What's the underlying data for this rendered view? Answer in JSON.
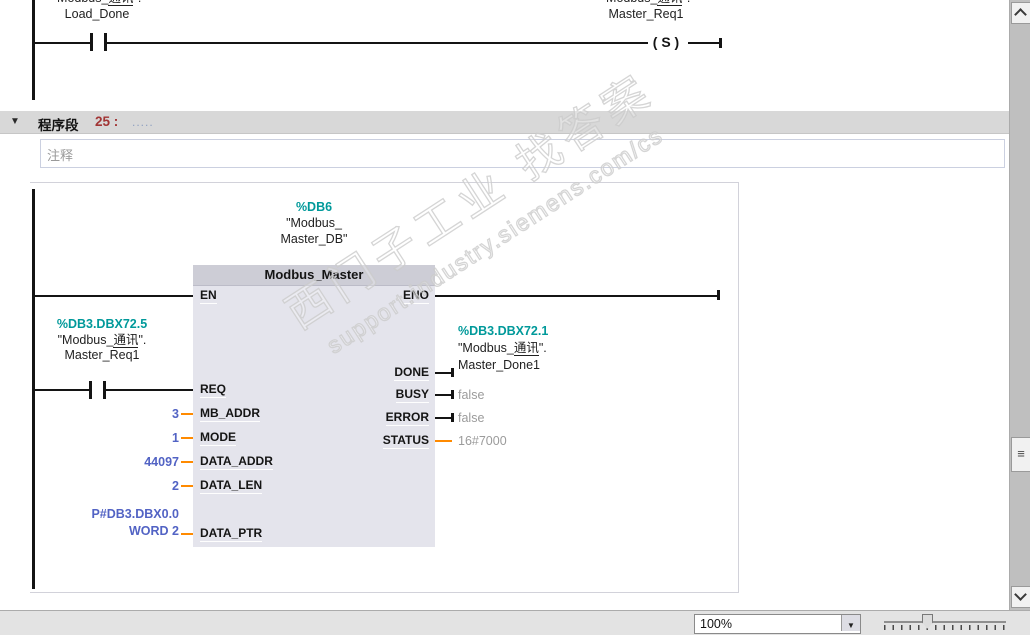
{
  "colors": {
    "address_teal": "#00999a",
    "value_blue": "#5263c4",
    "stub_orange": "#ff8a00",
    "monitor_grey": "#9b9b9b",
    "network_number_red": "#a23535",
    "block_body": "#e4e4ec",
    "block_header": "#cdcdd6",
    "network_header_bg": "#d8d8d8"
  },
  "top_network": {
    "left_contact": {
      "tag_prefix": "\"Modbus_",
      "tag_cjk": "通讯",
      "tag_suffix": "\".",
      "name": "Load_Done"
    },
    "right_coil": {
      "tag_prefix": "\"Modbus_",
      "tag_cjk": "通讯",
      "tag_suffix": "\".",
      "name": "Master_Req1",
      "symbol": "( S )"
    }
  },
  "network_header": {
    "collapse_glyph": "▼",
    "title": "程序段",
    "number": "25 :",
    "placeholder_dots": "....."
  },
  "comment": {
    "placeholder": "注释"
  },
  "fbd": {
    "instance_db": {
      "address": "%DB6",
      "name_line1": "\"Modbus_",
      "name_line2": "Master_DB\""
    },
    "block_title": "Modbus_Master",
    "pins_left": [
      "EN",
      "REQ",
      "MB_ADDR",
      "MODE",
      "DATA_ADDR",
      "DATA_LEN",
      "DATA_PTR"
    ],
    "pins_right": [
      "ENO",
      "DONE",
      "BUSY",
      "ERROR",
      "STATUS"
    ],
    "req_operand": {
      "address": "%DB3.DBX72.5",
      "tag_prefix": "\"Modbus_",
      "tag_cjk": "通讯",
      "tag_suffix": "\".",
      "name": "Master_Req1"
    },
    "done_operand": {
      "address": "%DB3.DBX72.1",
      "tag_prefix": "\"Modbus_",
      "tag_cjk": "通讯",
      "tag_suffix": "\".",
      "name": "Master_Done1"
    },
    "input_values": {
      "mb_addr": "3",
      "mode": "1",
      "data_addr": "44097",
      "data_len": "2",
      "data_ptr_line1": "P#DB3.DBX0.0",
      "data_ptr_line2": "WORD 2"
    },
    "output_values": {
      "busy": "false",
      "error": "false",
      "status": "16#7000"
    }
  },
  "watermark": {
    "line1": "西门子工业 找答案",
    "line2": "support.industry.siemens.com/cs"
  },
  "status_bar": {
    "zoom_value": "100%"
  }
}
